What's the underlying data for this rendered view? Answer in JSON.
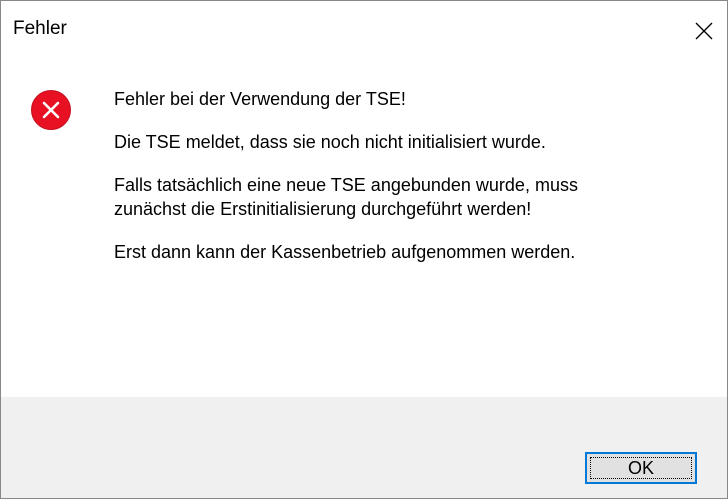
{
  "window": {
    "title": "Fehler",
    "close_icon": "close-icon"
  },
  "message": {
    "icon": "error-icon",
    "icon_color": "#e81123",
    "lines": [
      "Fehler bei der Verwendung der TSE!",
      "Die TSE meldet, dass sie noch nicht initialisiert wurde.",
      "Falls tatsächlich eine neue TSE angebunden wurde, muss",
      "zunächst die Erstinitialisierung durchgeführt werden!",
      "Erst dann kann der Kassenbetrieb aufgenommen werden."
    ]
  },
  "buttons": {
    "ok_label": "OK"
  },
  "colors": {
    "footer_background": "#f0f0f0",
    "button_focus_border": "#0078d7"
  }
}
